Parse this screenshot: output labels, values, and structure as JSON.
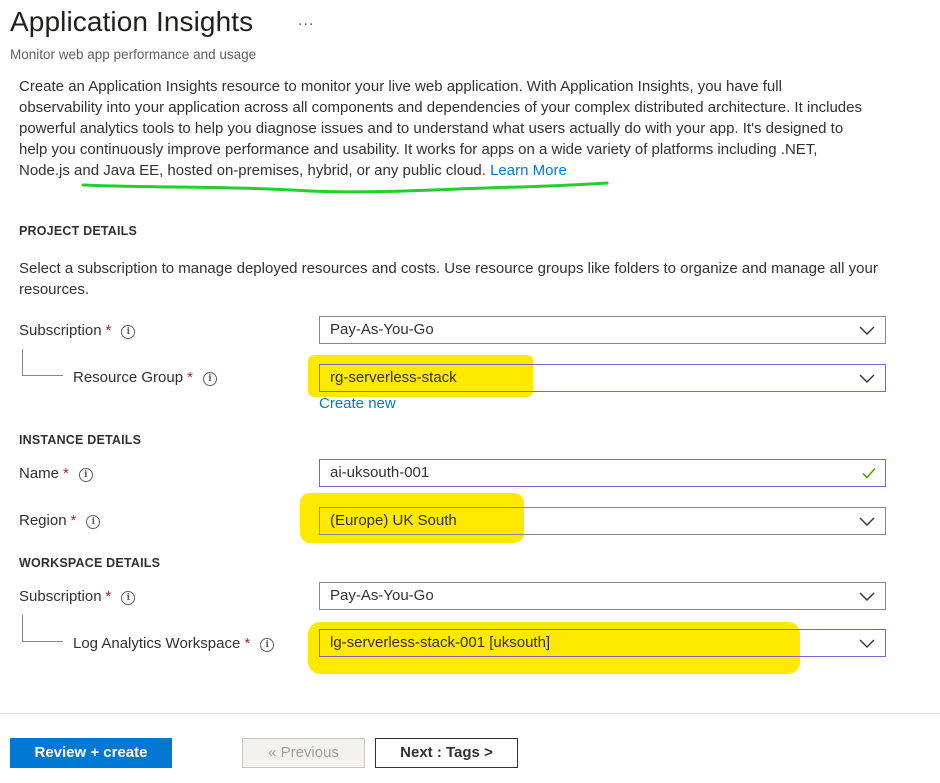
{
  "header": {
    "title": "Application Insights",
    "more": "...",
    "subtitle": "Monitor web app performance and usage"
  },
  "description": {
    "text": "Create an Application Insights resource to monitor your live web application. With Application Insights, you have full observability into your application across all components and dependencies of your complex distributed architecture. It includes powerful analytics tools to help you diagnose issues and to understand what users actually do with your app. It's designed to help you continuously improve performance and usability. It works for apps on a wide variety of platforms including .NET, Node.js and Java EE, hosted on-premises, hybrid, or any public cloud.",
    "learn_more": "Learn More"
  },
  "project": {
    "heading": "PROJECT DETAILS",
    "text": "Select a subscription to manage deployed resources and costs. Use resource groups like folders to organize and manage all your resources.",
    "subscription_label": "Subscription",
    "subscription_value": "Pay-As-You-Go",
    "resource_group_label": "Resource Group",
    "resource_group_value": "rg-serverless-stack",
    "create_new": "Create new"
  },
  "instance": {
    "heading": "INSTANCE DETAILS",
    "name_label": "Name",
    "name_value": "ai-uksouth-001",
    "region_label": "Region",
    "region_value": "(Europe) UK South"
  },
  "workspace": {
    "heading": "WORKSPACE DETAILS",
    "subscription_label": "Subscription",
    "subscription_value": "Pay-As-You-Go",
    "law_label": "Log Analytics Workspace",
    "law_value": "lg-serverless-stack-001 [uksouth]"
  },
  "common": {
    "required_mark": "*",
    "info_glyph": "i"
  },
  "footer": {
    "review_create": "Review + create",
    "previous": "« Previous",
    "next": "Next : Tags >"
  },
  "colors": {
    "accent": "#0078d4",
    "required": "#a4262c",
    "highlight": "#ffe900",
    "annotation_underline": "#22d02a",
    "valid_check": "#57a300",
    "focused_border": "#8661c5"
  },
  "icons": {
    "dropdown": "chevron-down-icon",
    "info": "info-icon",
    "valid": "checkmark-icon"
  }
}
